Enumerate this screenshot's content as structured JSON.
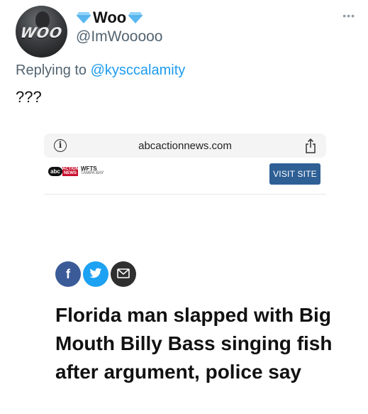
{
  "tweet": {
    "avatar_text": "WOO",
    "display_name": "Woo",
    "handle": "@ImWooooo",
    "reply_prefix": "Replying to",
    "reply_mention": "@kysccalamity",
    "text": "???",
    "more_icon": "more-icon",
    "name_icon": "diamond-icon"
  },
  "browser": {
    "url": "abcactionnews.com",
    "info_icon": "info-icon",
    "share_icon": "share-icon"
  },
  "site": {
    "logo_abc": "abc",
    "logo_action": "ACTION NEWS",
    "logo_call": "WFTS",
    "logo_city": "TAMPA BAY",
    "visit_label": "VISIT SITE"
  },
  "article": {
    "share_buttons": [
      "facebook-icon",
      "twitter-icon",
      "mail-icon"
    ],
    "facebook_glyph": "f",
    "headline": "Florida man slapped with Big Mouth Billy Bass singing fish after argument, police say"
  },
  "colors": {
    "link_blue": "#1d9bf0",
    "diamond": "#5ab8f0",
    "visit_button": "#2e5f95",
    "facebook": "#3b5b98",
    "twitter": "#1da1f2",
    "mail": "#2f2f2f"
  }
}
